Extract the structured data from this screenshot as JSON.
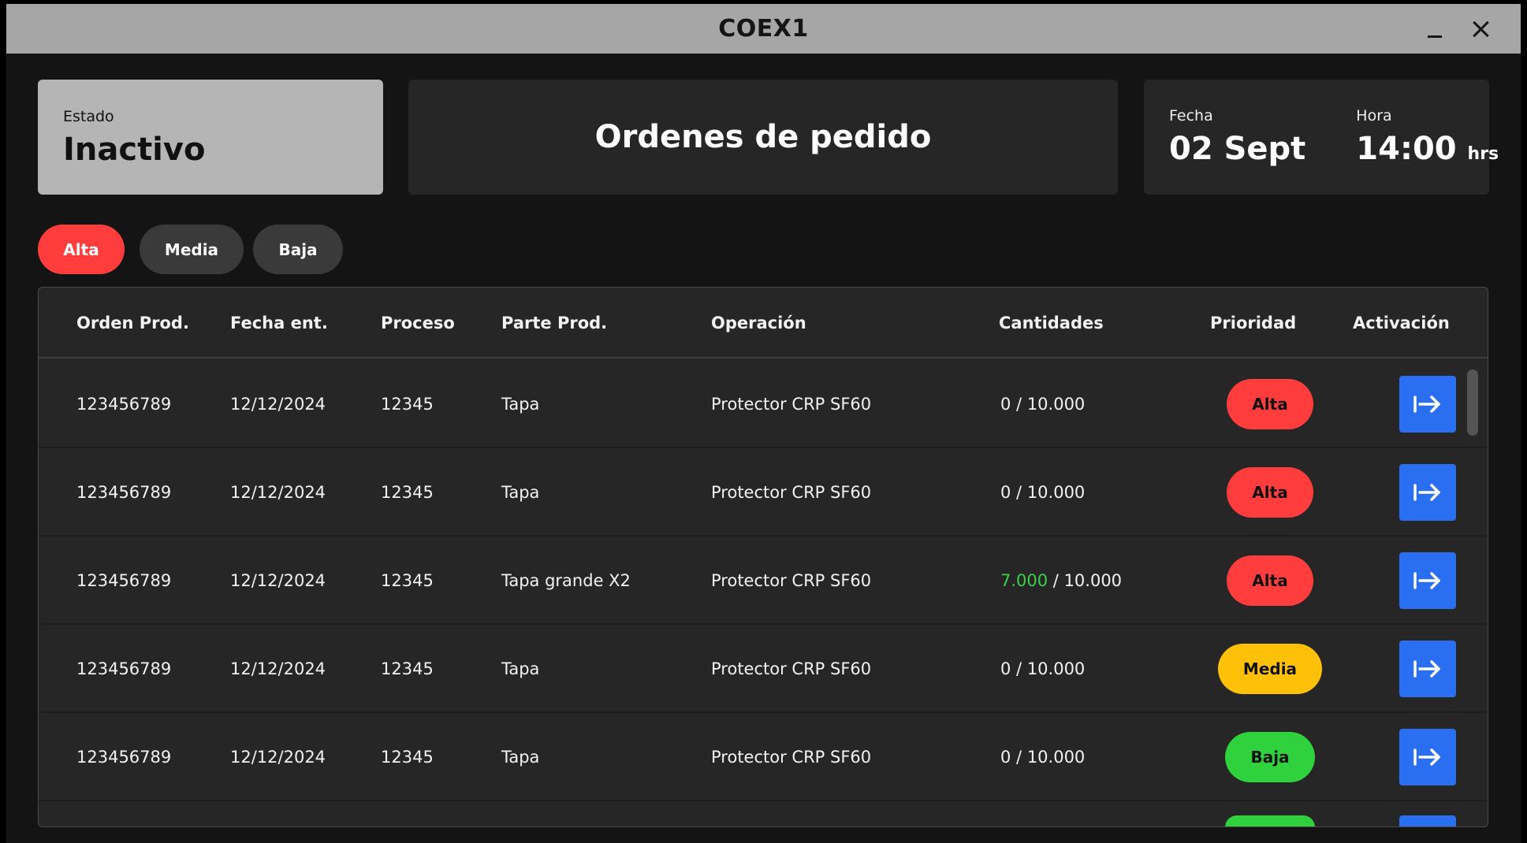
{
  "window": {
    "title": "COEX1"
  },
  "estado": {
    "label": "Estado",
    "value": "Inactivo"
  },
  "header": {
    "title": "Ordenes de pedido"
  },
  "fecha": {
    "label": "Fecha",
    "value": "02 Sept"
  },
  "hora": {
    "label": "Hora",
    "value": "14:00",
    "unit": "hrs"
  },
  "filters": {
    "alta": "Alta",
    "media": "Media",
    "baja": "Baja"
  },
  "table": {
    "columns": [
      "Orden Prod.",
      "Fecha ent.",
      "Proceso",
      "Parte Prod.",
      "Operación",
      "Cantidades",
      "Prioridad",
      "Activación"
    ],
    "rows": [
      {
        "orden": "123456789",
        "fecha": "12/12/2024",
        "proceso": "12345",
        "parte": "Tapa",
        "operacion": "Protector CRP SF60",
        "cant_done": "0",
        "cant_sep": " / ",
        "cant_total": "10.000",
        "prioridad": "Alta"
      },
      {
        "orden": "123456789",
        "fecha": "12/12/2024",
        "proceso": "12345",
        "parte": "Tapa",
        "operacion": "Protector CRP SF60",
        "cant_done": "0",
        "cant_sep": " / ",
        "cant_total": "10.000",
        "prioridad": "Alta"
      },
      {
        "orden": "123456789",
        "fecha": "12/12/2024",
        "proceso": "12345",
        "parte": "Tapa grande X2",
        "operacion": "Protector CRP SF60",
        "cant_done": "7.000",
        "cant_sep": " / ",
        "cant_total": "10.000",
        "prioridad": "Alta"
      },
      {
        "orden": "123456789",
        "fecha": "12/12/2024",
        "proceso": "12345",
        "parte": "Tapa",
        "operacion": "Protector CRP SF60",
        "cant_done": "0",
        "cant_sep": " / ",
        "cant_total": "10.000",
        "prioridad": "Media"
      },
      {
        "orden": "123456789",
        "fecha": "12/12/2024",
        "proceso": "12345",
        "parte": "Tapa",
        "operacion": "Protector CRP SF60",
        "cant_done": "0",
        "cant_sep": " / ",
        "cant_total": "10.000",
        "prioridad": "Baja"
      }
    ]
  },
  "colors": {
    "alta": "#ff3d3d",
    "media": "#ffc107",
    "baja": "#2fd13d",
    "action": "#2a6ff2",
    "progress": "#3ccf4a"
  },
  "icons": {
    "minimize": "minimize-icon",
    "close": "close-icon",
    "activate": "arrow-right-to-bar-icon"
  }
}
